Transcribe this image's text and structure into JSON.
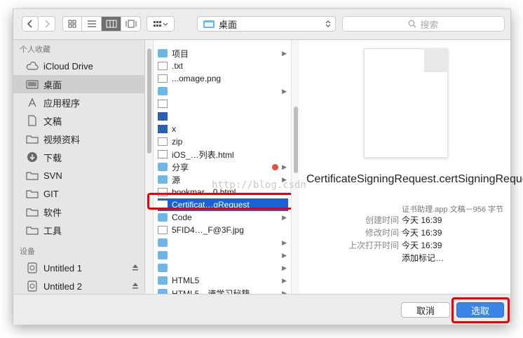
{
  "toolbar": {
    "back_icon": "chevron-left-icon",
    "forward_icon": "chevron-right-icon",
    "view_modes": [
      "icon-view",
      "list-view",
      "column-view",
      "coverflow-view"
    ],
    "active_view": "column-view",
    "arrange_icon": "arrange-grid-icon",
    "path_label": "桌面",
    "search_placeholder": "搜索"
  },
  "sidebar": {
    "favorites_header": "个人收藏",
    "favorites": [
      {
        "label": "iCloud Drive",
        "icon": "cloud-icon"
      },
      {
        "label": "桌面",
        "icon": "desktop-icon",
        "selected": true
      },
      {
        "label": "应用程序",
        "icon": "applications-icon"
      },
      {
        "label": "文稿",
        "icon": "document-icon"
      },
      {
        "label": "视频资料",
        "icon": "folder-icon"
      },
      {
        "label": "下载",
        "icon": "download-icon"
      },
      {
        "label": "SVN",
        "icon": "folder-icon"
      },
      {
        "label": "GIT",
        "icon": "folder-icon"
      },
      {
        "label": "软件",
        "icon": "folder-icon"
      },
      {
        "label": "工具",
        "icon": "folder-icon"
      }
    ],
    "devices_header": "设备",
    "devices": [
      {
        "label": "Untitled 1",
        "icon": "disk-icon"
      },
      {
        "label": "Untitled 2",
        "icon": "disk-icon"
      }
    ]
  },
  "files": [
    {
      "name": "项目",
      "icon": "folder",
      "arrow": true
    },
    {
      "name": ".txt",
      "icon": "doc"
    },
    {
      "name": "...omage.png",
      "icon": "doc"
    },
    {
      "name": "",
      "icon": "folder",
      "arrow": true
    },
    {
      "name": "",
      "icon": "doc"
    },
    {
      "name": "",
      "icon": "word"
    },
    {
      "name": "x",
      "icon": "word"
    },
    {
      "name": "zip",
      "icon": "doc"
    },
    {
      "name": "iOS_…列表.html",
      "icon": "doc"
    },
    {
      "name": "分享",
      "icon": "folder",
      "arrow": true,
      "tag": "#e84c3d"
    },
    {
      "name": "源",
      "icon": "folder",
      "arrow": true
    },
    {
      "name": "bookmar…0.html",
      "icon": "doc"
    },
    {
      "name": "Certificat…gRequest",
      "icon": "doc",
      "selected": true
    },
    {
      "name": "Code",
      "icon": "folder",
      "arrow": true
    },
    {
      "name": "5FID4…_F@3F.jpg",
      "icon": "doc"
    },
    {
      "name": "",
      "icon": "folder",
      "arrow": true
    },
    {
      "name": "",
      "icon": "folder",
      "arrow": true
    },
    {
      "name": "",
      "icon": "folder",
      "arrow": true
    },
    {
      "name": "HTML5",
      "icon": "folder",
      "arrow": true
    },
    {
      "name": "HTML5…速学习秘籍",
      "icon": "folder",
      "arrow": true
    }
  ],
  "preview": {
    "filename": "CertificateSigningRequest.certSigningRequest",
    "kind": "证书助理.app 文稿－956 字节",
    "created_label": "创建时间",
    "created_value": "今天 16:39",
    "modified_label": "修改时间",
    "modified_value": "今天 16:39",
    "opened_label": "上次打开时间",
    "opened_value": "今天 16:39",
    "add_tags": "添加标记…"
  },
  "watermark": "http://blog.csdn",
  "buttons": {
    "cancel": "取消",
    "choose": "选取"
  },
  "colors": {
    "selection": "#1762d8",
    "primary_button": "#3a86e8",
    "highlight": "#e00000",
    "folder": "#6cb6ea"
  }
}
